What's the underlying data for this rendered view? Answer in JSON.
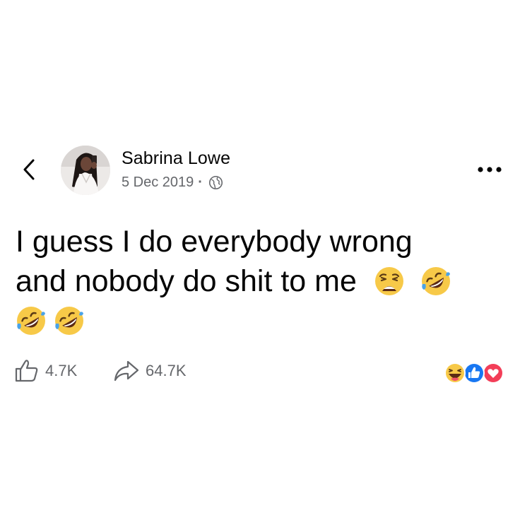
{
  "post": {
    "author_name": "Sabrina Lowe",
    "date": "5 Dec 2019",
    "separator": "·",
    "privacy_icon": "globe-icon",
    "text_line1": "I guess I do everybody wrong",
    "text_line2": "and nobody do shit to me",
    "emojis": [
      "weary-face-emoji",
      "rolling-on-floor-laughing-emoji",
      "rolling-on-floor-laughing-emoji",
      "rolling-on-floor-laughing-emoji"
    ]
  },
  "actions": {
    "like_icon": "thumbs-up-outline-icon",
    "like_count": "4.7K",
    "share_icon": "share-arrow-icon",
    "share_count": "64.7K"
  },
  "reactions": [
    "haha-reaction",
    "like-reaction",
    "love-reaction"
  ],
  "navigation": {
    "back_icon": "chevron-left-icon",
    "more_icon": "more-horizontal-icon"
  },
  "colors": {
    "text": "#050505",
    "secondary_text": "#65676b",
    "like_blue": "#1877f2",
    "love_red": "#f33e58",
    "emoji_yellow": "#f7c948"
  }
}
